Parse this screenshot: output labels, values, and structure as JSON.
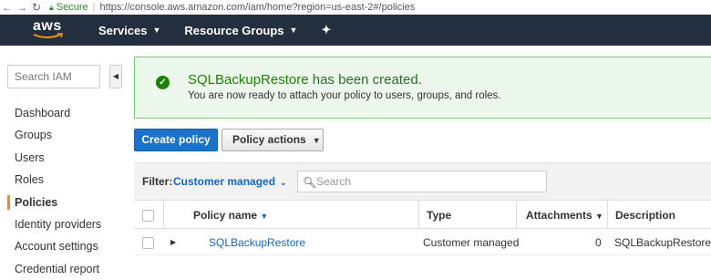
{
  "browser": {
    "secure_label": "Secure",
    "url": "https://console.aws.amazon.com/iam/home?region=us-east-2#/policies"
  },
  "nav": {
    "logo": "aws",
    "services": "Services",
    "resource_groups": "Resource Groups"
  },
  "sidebar": {
    "search_placeholder": "Search IAM",
    "items": [
      {
        "label": "Dashboard"
      },
      {
        "label": "Groups"
      },
      {
        "label": "Users"
      },
      {
        "label": "Roles"
      },
      {
        "label": "Policies"
      },
      {
        "label": "Identity providers"
      },
      {
        "label": "Account settings"
      },
      {
        "label": "Credential report"
      }
    ],
    "active": "Policies"
  },
  "flash": {
    "policy_name": "SQLBackupRestore",
    "title_suffix": " has been created.",
    "message": "You are now ready to attach your policy to users, groups, and roles."
  },
  "actions": {
    "create_policy": "Create policy",
    "policy_actions": "Policy actions"
  },
  "filter": {
    "label": "Filter:",
    "value": "Customer managed",
    "search_placeholder": "Search"
  },
  "table": {
    "columns": [
      "Policy name",
      "Type",
      "Attachments",
      "Description"
    ],
    "rows": [
      {
        "name": "SQLBackupRestore",
        "type": "Customer managed",
        "attachments": "0",
        "description": "SQLBackupRestore"
      }
    ]
  },
  "colors": {
    "nav_bg": "#232f3e",
    "primary": "#1a73c8",
    "success": "#1d8102",
    "active_marker": "#e88a2a"
  }
}
